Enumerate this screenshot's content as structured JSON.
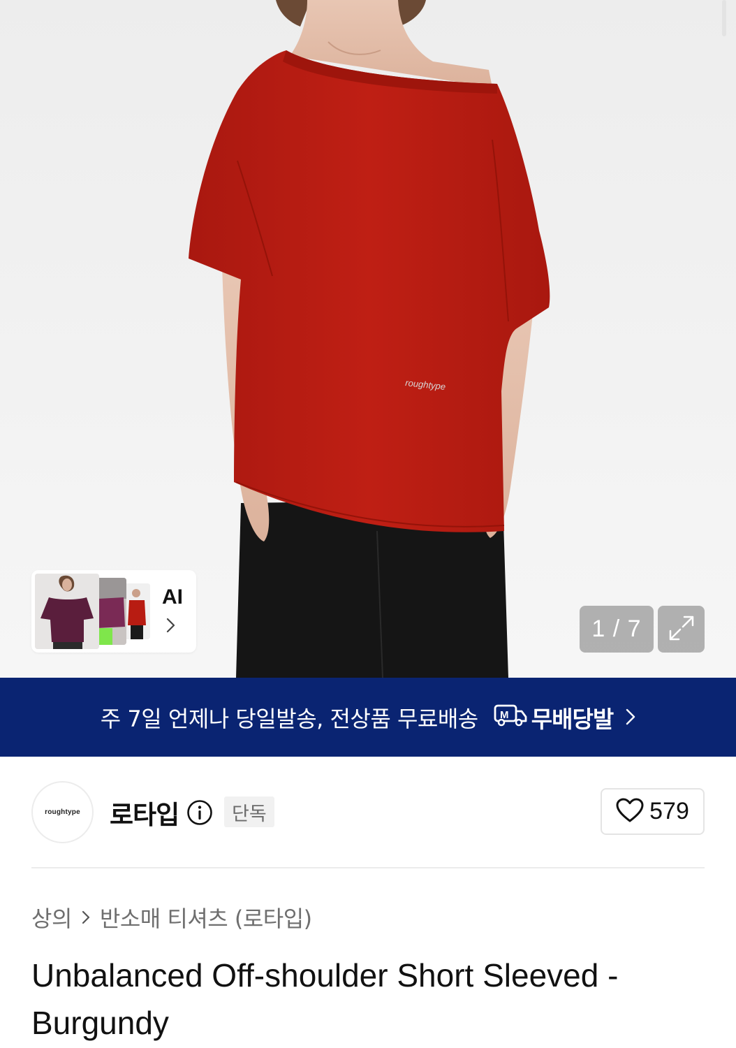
{
  "gallery": {
    "pager_text": "1 / 7",
    "ai_label": "AI"
  },
  "banner": {
    "text": "주 7일 언제나 당일발송, 전상품 무료배송",
    "brand_label": "무배당발",
    "color": "#0a2472"
  },
  "brand": {
    "logo_text": "roughtype",
    "name": "로타입",
    "badge": "단독",
    "like_count": "579"
  },
  "breadcrumb": {
    "items": [
      "상의",
      "반소매 티셔츠 (로타입)"
    ]
  },
  "product": {
    "title": "Unbalanced Off-shoulder Short Sleeved - Burgundy",
    "shirt_logo": "roughtype"
  },
  "colors": {
    "shirt": "#b81c12",
    "pants": "#151515",
    "badge_bg": "#f1f1f1"
  }
}
